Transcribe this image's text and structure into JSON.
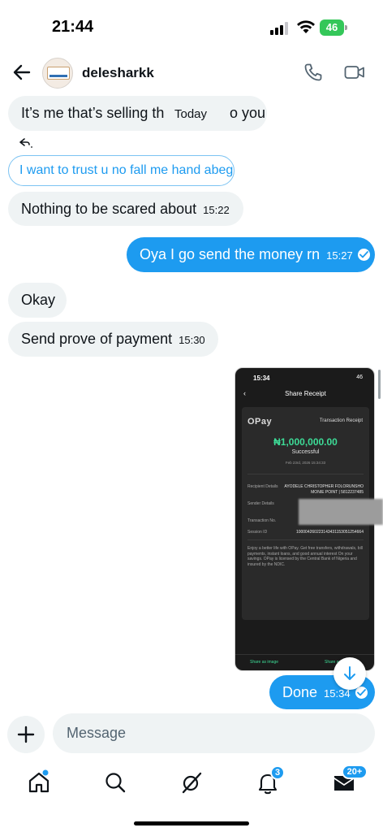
{
  "status_bar": {
    "time": "21:44",
    "battery": "46"
  },
  "header": {
    "username": "delesharkk"
  },
  "messages": {
    "m1_text": "It’s me that’s selling th",
    "m1_end": "o you",
    "today_label": "Today",
    "quoted_reply": "I want to trust u no fall me hand abeg",
    "m2_text": "Nothing to be scared about",
    "m2_time": "15:22",
    "m3_text": "Oya I go send the money rn",
    "m3_time": "15:27",
    "m4_text": "Okay",
    "m5_text": "Send prove of payment",
    "m5_time": "15:30",
    "m6_text": "Done",
    "m6_time": "15:34"
  },
  "receipt": {
    "time": "15:34",
    "status": "46",
    "title": "Share Receipt",
    "logo": "OPay",
    "trx_label": "Transaction Receipt",
    "amount": "₦1,000,000.00",
    "status_text": "Successful",
    "date": "Feb 23rd, 2026 15:34:33",
    "recipient_label": "Recipient Details",
    "recipient_name": "AYODELE CHRISTOPHER FOLORUNSHO",
    "recipient_bank": "MONIE POINT | 5812237485",
    "sender_label": "Sender Details",
    "txn_label": "Transaction No.",
    "session_label": "Session ID",
    "session_value": "100004260223143431153051254664",
    "footer": "Enjoy a better life with OPay. Get free transfers, withdrawals, bill payments, instant loans, and good annual interest On your savings. OPay is licensed by the Central Bank of Nigeria and insured by the NDIC.",
    "share_image": "Share as image",
    "share_pdf": "Share as PDF"
  },
  "composer": {
    "placeholder": "Message"
  },
  "nav": {
    "notifications_badge": "3",
    "messages_badge": "20+"
  },
  "colors": {
    "accent": "#1d9bf0",
    "bubble_received": "#eff3f4",
    "opay_green": "#3ddc97"
  },
  "icons": [
    "back-arrow-icon",
    "phone-icon",
    "video-icon",
    "reply-icon",
    "check-icon",
    "arrow-down-icon",
    "plus-icon",
    "home-icon",
    "search-icon",
    "grok-icon",
    "bell-icon",
    "mail-icon"
  ]
}
